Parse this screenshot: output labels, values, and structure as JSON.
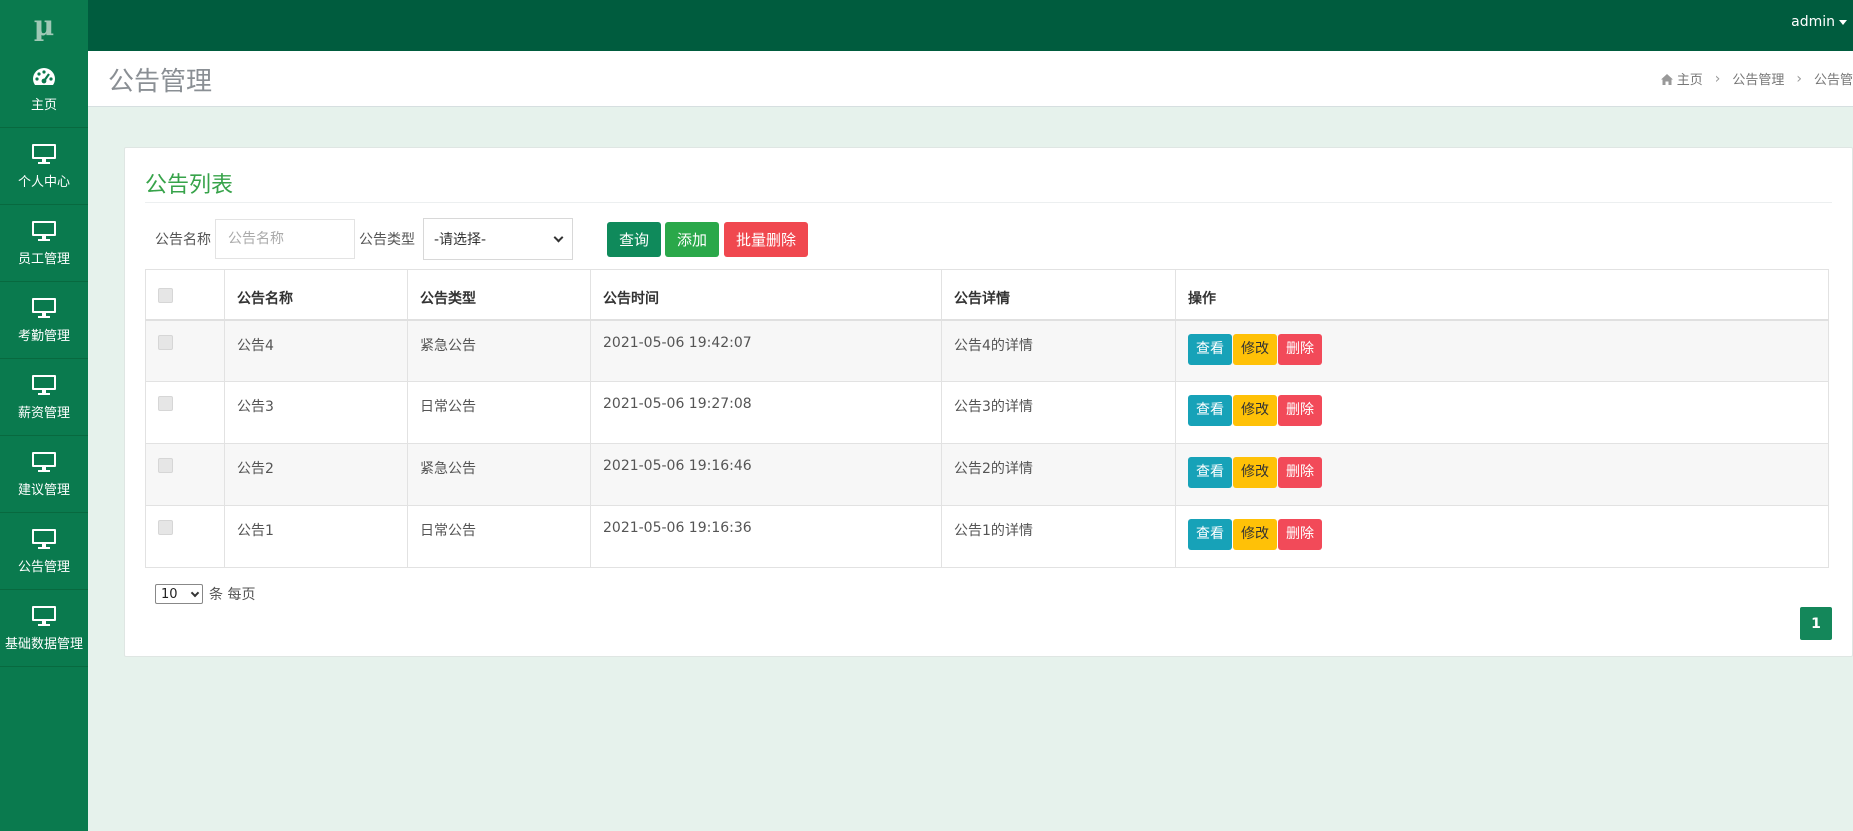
{
  "logo": "µ",
  "topbar": {
    "user": "admin"
  },
  "sidebar": {
    "items": [
      {
        "label": "主页",
        "icon": "dashboard-icon"
      },
      {
        "label": "个人中心",
        "icon": "monitor-icon"
      },
      {
        "label": "员工管理",
        "icon": "monitor-icon"
      },
      {
        "label": "考勤管理",
        "icon": "monitor-icon"
      },
      {
        "label": "薪资管理",
        "icon": "monitor-icon"
      },
      {
        "label": "建议管理",
        "icon": "monitor-icon"
      },
      {
        "label": "公告管理",
        "icon": "monitor-icon"
      },
      {
        "label": "基础数据管理",
        "icon": "monitor-icon"
      }
    ]
  },
  "page": {
    "title": "公告管理",
    "breadcrumb": [
      "主页",
      "公告管理",
      "公告管"
    ]
  },
  "panel": {
    "title": "公告列表"
  },
  "search": {
    "name_label": "公告名称",
    "name_placeholder": "公告名称",
    "type_label": "公告类型",
    "type_selected": "-请选择-",
    "query_btn": "查询",
    "add_btn": "添加",
    "batch_delete_btn": "批量删除"
  },
  "table": {
    "headers": [
      "公告名称",
      "公告类型",
      "公告时间",
      "公告详情",
      "操作"
    ],
    "rows": [
      {
        "name": "公告4",
        "type": "紧急公告",
        "time": "2021-05-06 19:42:07",
        "detail": "公告4的详情"
      },
      {
        "name": "公告3",
        "type": "日常公告",
        "time": "2021-05-06 19:27:08",
        "detail": "公告3的详情"
      },
      {
        "name": "公告2",
        "type": "紧急公告",
        "time": "2021-05-06 19:16:46",
        "detail": "公告2的详情"
      },
      {
        "name": "公告1",
        "type": "日常公告",
        "time": "2021-05-06 19:16:36",
        "detail": "公告1的详情"
      }
    ],
    "actions": {
      "view": "查看",
      "edit": "修改",
      "delete": "删除"
    }
  },
  "pagination": {
    "page_size": "10",
    "page_size_suffix": "条 每页",
    "current_page": "1"
  },
  "colors": {
    "topbar": "#005c3e",
    "sidebar": "#0a7a4e",
    "accent": "#37a34a",
    "danger": "#f0484f",
    "warning": "#ffc107",
    "info": "#17a2b8"
  }
}
